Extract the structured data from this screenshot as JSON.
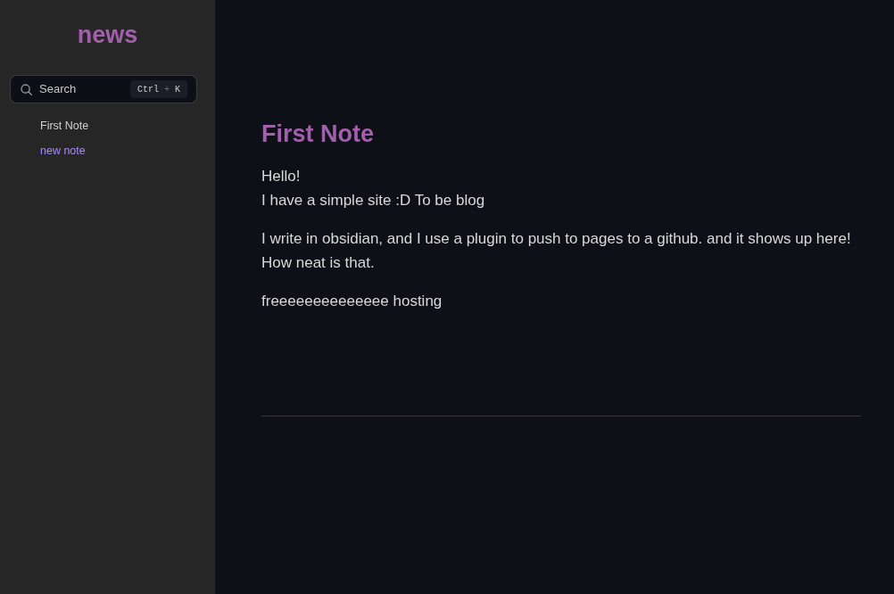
{
  "sidebar": {
    "site_title": "news",
    "search": {
      "label": "Search",
      "shortcut": {
        "keys": [
          "Ctrl",
          "K"
        ],
        "separator": "+"
      }
    },
    "items": [
      {
        "label": "First Note",
        "selected": false
      },
      {
        "label": "new note",
        "selected": true
      }
    ]
  },
  "note": {
    "title": "First Note",
    "paragraphs": [
      {
        "lines": [
          "Hello!",
          "I have a simple site :D To be blog"
        ]
      },
      {
        "lines": [
          "I write in obsidian, and I use a plugin to push to pages to a github. and it shows up here!",
          "How neat is that."
        ]
      },
      {
        "lines": [
          "freeeeeeeeeeeeee hosting"
        ]
      }
    ]
  }
}
